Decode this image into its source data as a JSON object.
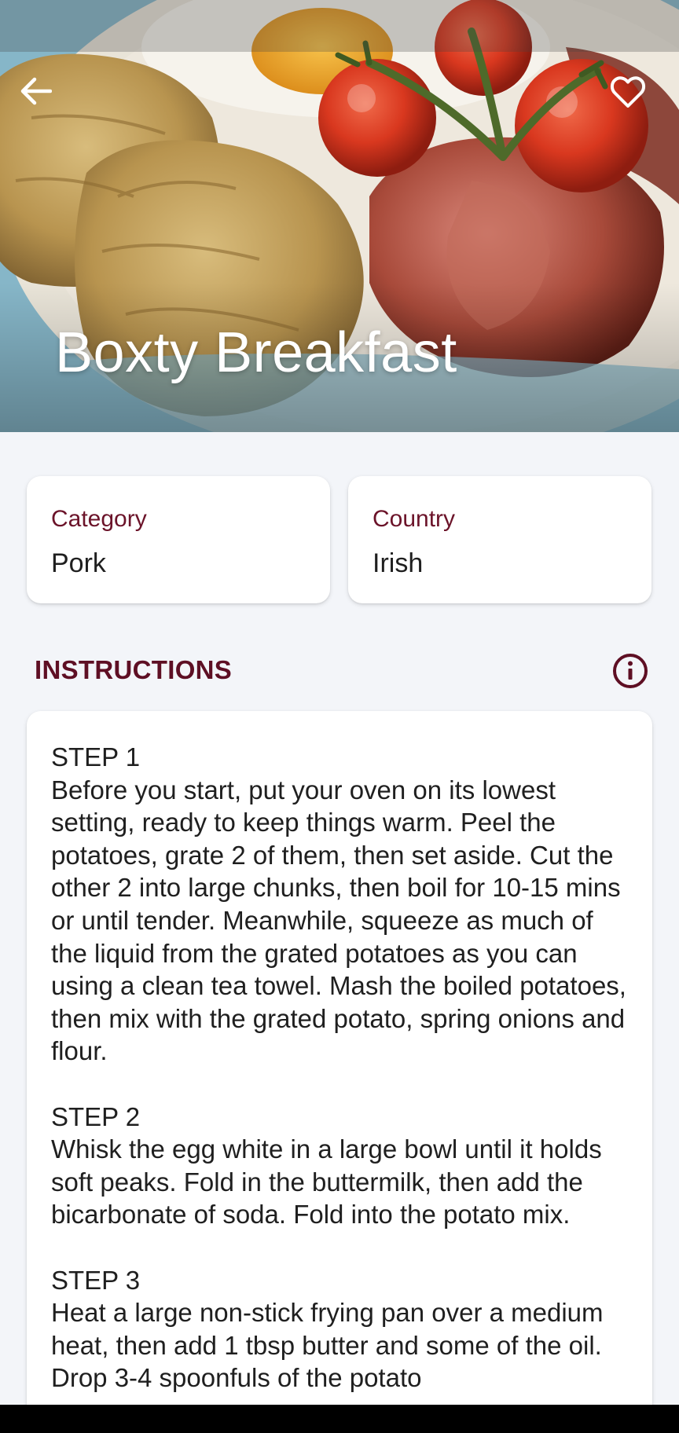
{
  "header": {
    "title": "Boxty Breakfast",
    "back_icon": "arrow-back-icon",
    "favorite_icon": "heart-outline-icon"
  },
  "info": {
    "category": {
      "label": "Category",
      "value": "Pork"
    },
    "country": {
      "label": "Country",
      "value": "Irish"
    }
  },
  "instructions": {
    "title": "INSTRUCTIONS",
    "info_icon": "info-circle-icon",
    "text": "STEP 1\nBefore you start, put your oven on its lowest setting, ready to keep things warm. Peel the potatoes, grate 2 of them, then set aside. Cut the other 2 into large chunks, then boil for 10-15 mins or until tender. Meanwhile, squeeze as much of the liquid from the grated potatoes as you can using a clean tea towel. Mash the boiled potatoes, then mix with the grated potato, spring onions and flour.\n\nSTEP 2\nWhisk the egg white in a large bowl until it holds soft peaks. Fold in the buttermilk, then add the bicarbonate of soda. Fold into the potato mix.\n\nSTEP 3\nHeat a large non-stick frying pan over a medium heat, then add 1 tbsp butter and some of the oil. Drop 3-4 spoonfuls of the potato"
  },
  "colors": {
    "accent": "#5e0f24",
    "label": "#6b1329",
    "background": "#f3f5f9",
    "card": "#ffffff"
  }
}
